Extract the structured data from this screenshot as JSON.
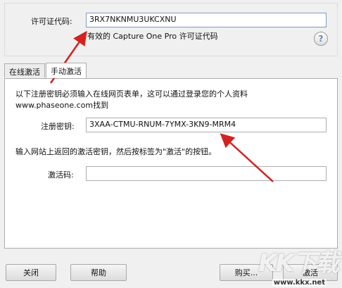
{
  "license": {
    "label": "许可证代码:",
    "value": "3RX7NKNMU3UKCXNU",
    "hint": "有效的 Capture One Pro 许可证代码"
  },
  "tabs": [
    {
      "label": "在线激活",
      "active": false
    },
    {
      "label": "手动激活",
      "active": true
    }
  ],
  "manual": {
    "intro_line1": "以下注册密钥必须输入在线网页表单，这可以通过登录您的个人资料",
    "intro_line2": "www.phaseone.com找到",
    "reg_key_label": "注册密钥:",
    "reg_key_value": "3XAA-CTMU-RNUM-7YMX-3KN9-MRM4",
    "instruction": "输入网站上返回的激活密钥，然后按标签为\"激活\"的按钮。",
    "activation_label": "激活码:",
    "activation_value": ""
  },
  "buttons": {
    "close": "关闭",
    "help": "帮助",
    "buy": "购买...",
    "activate": "激活"
  },
  "watermark": {
    "logo": "KK下载",
    "url": "www.kkx.net"
  },
  "colors": {
    "arrow": "#d32222",
    "field_focus_border": "#7a9cc6"
  }
}
